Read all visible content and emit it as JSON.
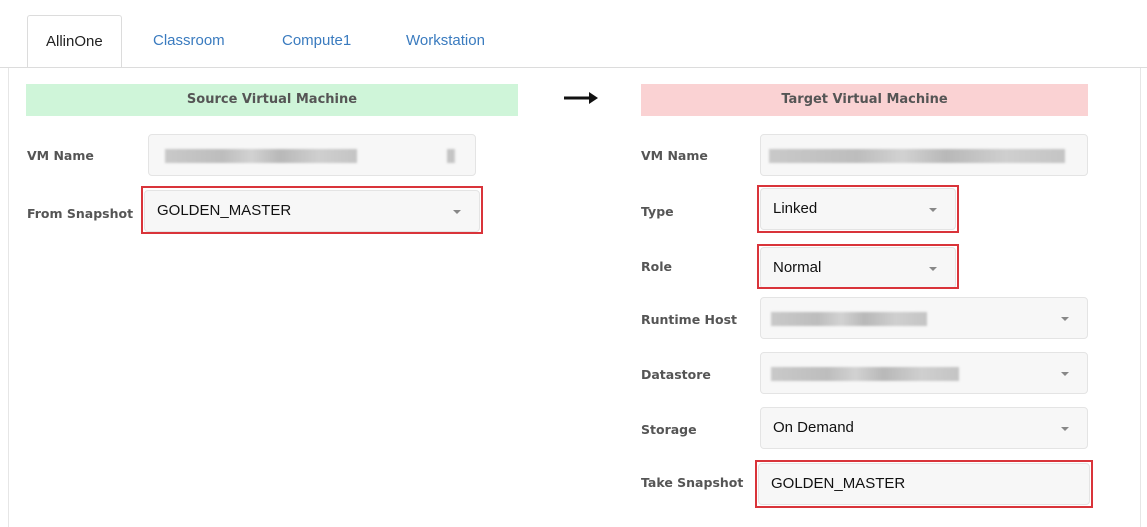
{
  "tabs": [
    {
      "label": "AllinOne",
      "active": true
    },
    {
      "label": "Classroom",
      "active": false
    },
    {
      "label": "Compute1",
      "active": false
    },
    {
      "label": "Workstation",
      "active": false
    }
  ],
  "source": {
    "header": "Source Virtual Machine",
    "vm_name_label": "VM Name",
    "from_snapshot_label": "From Snapshot",
    "from_snapshot_value": "GOLDEN_MASTER"
  },
  "target": {
    "header": "Target Virtual Machine",
    "vm_name_label": "VM Name",
    "type_label": "Type",
    "type_value": "Linked",
    "role_label": "Role",
    "role_value": "Normal",
    "runtime_host_label": "Runtime Host",
    "datastore_label": "Datastore",
    "storage_label": "Storage",
    "storage_value": "On Demand",
    "take_snapshot_label": "Take Snapshot",
    "take_snapshot_value": "GOLDEN_MASTER"
  },
  "colors": {
    "source_header_bg": "#cff5d9",
    "target_header_bg": "#fad2d3",
    "highlight": "#d9343a",
    "tab_link": "#3a7bbf"
  },
  "icons": {
    "arrow": "right-arrow-icon",
    "dropdown": "caret-down-icon"
  }
}
